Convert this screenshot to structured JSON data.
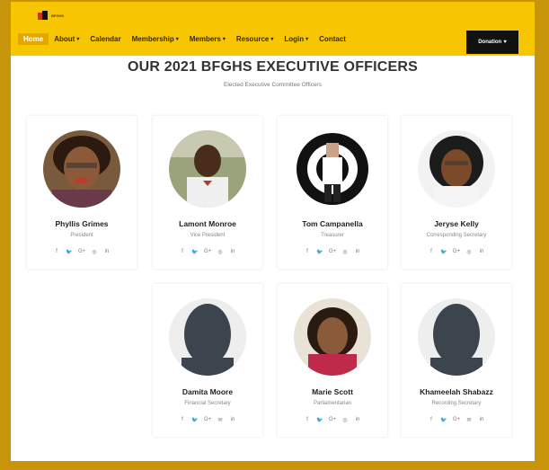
{
  "site": {
    "logo_text": "BFGHS"
  },
  "nav": {
    "items": [
      {
        "label": "Home",
        "active": true,
        "caret": false
      },
      {
        "label": "About",
        "caret": true
      },
      {
        "label": "Calendar",
        "caret": false
      },
      {
        "label": "Membership",
        "caret": true
      },
      {
        "label": "Members",
        "caret": true
      },
      {
        "label": "Resource",
        "caret": true
      },
      {
        "label": "Login",
        "caret": true
      },
      {
        "label": "Contact",
        "caret": false
      }
    ],
    "donate_label": "Donation"
  },
  "page": {
    "title": "OUR 2021 BFGHS EXECUTIVE OFFICERS",
    "subtitle": "Elected Executive Committee Officers"
  },
  "officers": [
    {
      "name": "Phyllis Grimes",
      "role": "President"
    },
    {
      "name": "Lamont Monroe",
      "role": "Vice President"
    },
    {
      "name": "Tom Campanella",
      "role": "Treasurer"
    },
    {
      "name": "Jeryse Kelly",
      "role": "Corresponding Secretary"
    },
    {
      "name": "Damita Moore",
      "role": "Financial Secretary"
    },
    {
      "name": "Marie Scott",
      "role": "Parliamentarian"
    },
    {
      "name": "Khameelah Shabazz",
      "role": "Recording Secretary"
    }
  ],
  "social_icons": [
    "facebook-icon",
    "twitter-icon",
    "google-plus-icon",
    "instagram-icon",
    "linkedin-icon"
  ],
  "colors": {
    "nav_bg": "#f7c600",
    "frame": "#c7940a",
    "donate_bg": "#111111"
  }
}
